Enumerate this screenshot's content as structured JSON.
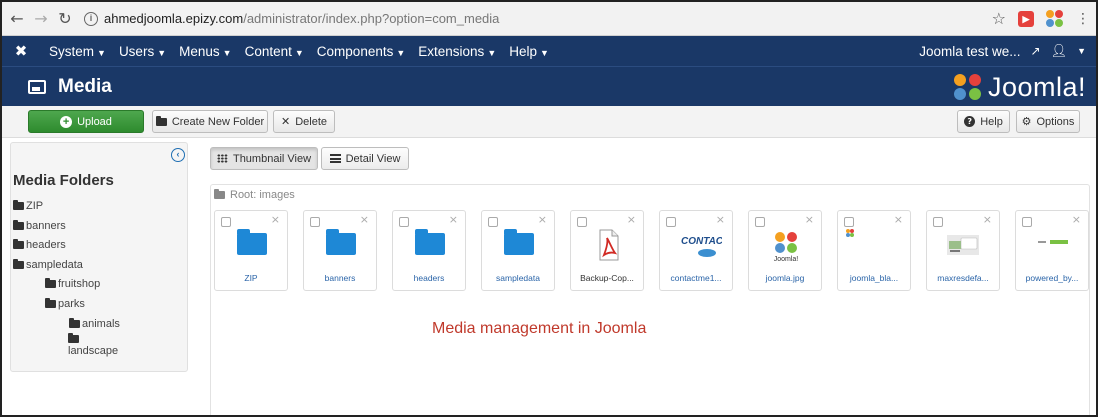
{
  "browser": {
    "back_icon": "arrow-left-icon",
    "forward_icon": "arrow-right-icon",
    "reload_icon": "reload-icon",
    "url_host": "ahmedjoomla.epizy.com",
    "url_path": "/administrator/index.php?option=com_media"
  },
  "admin_menu": {
    "items": [
      {
        "label": "System"
      },
      {
        "label": "Users"
      },
      {
        "label": "Menus"
      },
      {
        "label": "Content"
      },
      {
        "label": "Components"
      },
      {
        "label": "Extensions"
      },
      {
        "label": "Help"
      }
    ],
    "site_link": "Joomla test we...",
    "user_icon": "user-icon"
  },
  "header": {
    "title": "Media",
    "brand": "Joomla!"
  },
  "toolbar": {
    "upload_label": "Upload",
    "create_folder_label": "Create New Folder",
    "delete_label": "Delete",
    "help_label": "Help",
    "options_label": "Options"
  },
  "sidebar": {
    "title": "Media Folders",
    "folders": [
      {
        "label": "ZIP"
      },
      {
        "label": "banners"
      },
      {
        "label": "headers"
      },
      {
        "label": "sampledata"
      },
      {
        "label": "fruitshop"
      },
      {
        "label": "parks"
      },
      {
        "label": "animals"
      },
      {
        "label": "landscape"
      }
    ]
  },
  "main": {
    "thumbnail_view_label": "Thumbnail View",
    "detail_view_label": "Detail View",
    "root_label": "Root: images",
    "items": [
      {
        "label": "ZIP",
        "kind": "folder"
      },
      {
        "label": "banners",
        "kind": "folder"
      },
      {
        "label": "headers",
        "kind": "folder"
      },
      {
        "label": "sampledata",
        "kind": "folder"
      },
      {
        "label": "Backup-Cop...",
        "kind": "pdf"
      },
      {
        "label": "contactme1...",
        "kind": "image",
        "preview_text": "CONTACT"
      },
      {
        "label": "joomla.jpg",
        "kind": "image",
        "preview_text": "Joomla!"
      },
      {
        "label": "joomla_bla...",
        "kind": "image"
      },
      {
        "label": "maxresdefa...",
        "kind": "image"
      },
      {
        "label": "powered_by...",
        "kind": "image"
      }
    ],
    "caption": "Media management in Joomla"
  },
  "colors": {
    "navy": "#1a3867",
    "upload_green": "#2e8b2e",
    "folder_blue": "#1e88d6",
    "link_blue": "#2a64a8",
    "caption_red": "#c0392b"
  }
}
